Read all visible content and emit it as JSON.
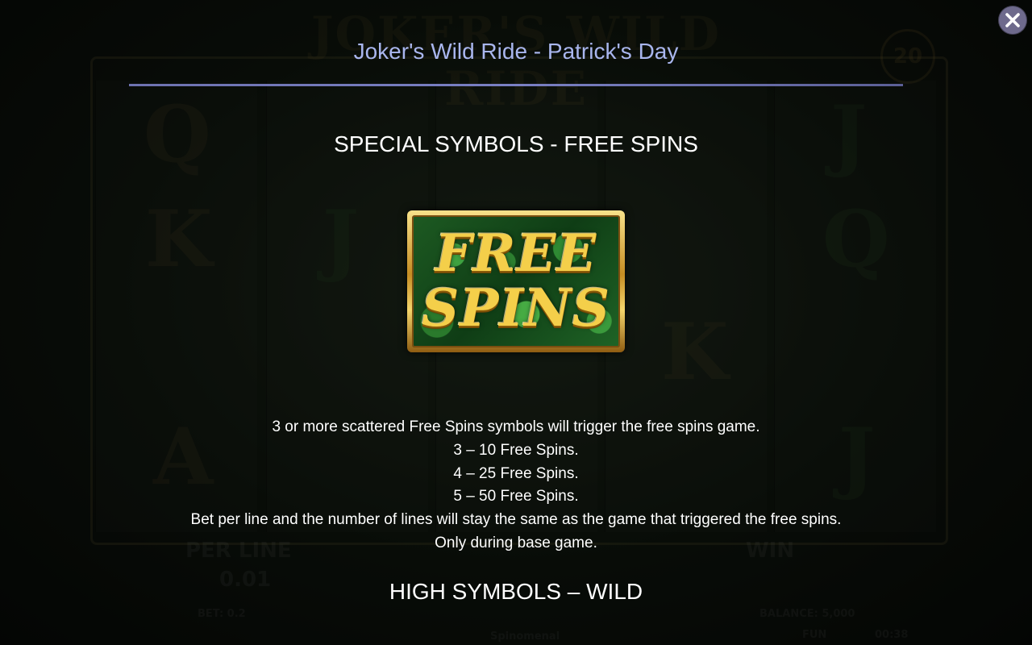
{
  "header": {
    "title": "Joker's Wild Ride - Patrick's Day",
    "close_icon": "close-icon"
  },
  "sections": {
    "free_spins": {
      "heading": "SPECIAL SYMBOLS - FREE SPINS",
      "symbol_line1": "FREE",
      "symbol_line2": "SPINS",
      "lines": [
        "3 or more scattered Free Spins symbols will trigger the free spins game.",
        "3 – 10 Free Spins.",
        "4 – 25 Free Spins.",
        "5 – 50 Free Spins.",
        "Bet per line and the number of lines will stay the same as the game that triggered the free spins.",
        "Only during base game."
      ]
    },
    "next_heading": "HIGH SYMBOLS – WILD"
  },
  "colors": {
    "title": "#a9b6ee",
    "rule": "#7a80c4",
    "text": "#ffffff",
    "close_button": "#6e6a8c"
  }
}
